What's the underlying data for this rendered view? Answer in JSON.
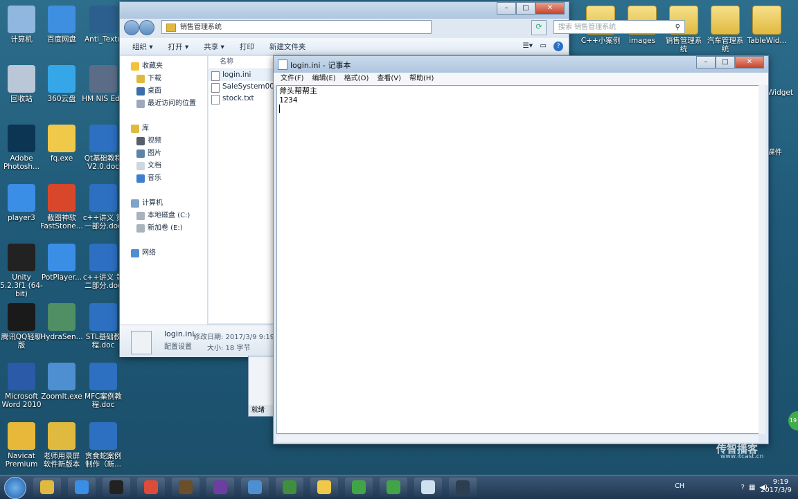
{
  "desktop_left": [
    {
      "label": "计算机",
      "icon": "computer-icon",
      "color": "#8fb7df"
    },
    {
      "label": "百度网盘",
      "icon": "baidu-netdisk-icon",
      "color": "#3e8fe0"
    },
    {
      "label": "Anti_Textu",
      "icon": "app-icon",
      "color": "#2c5f8d"
    },
    {
      "label": "回收站",
      "icon": "recycle-bin-icon",
      "color": "#b9c7d6"
    },
    {
      "label": "360云盘",
      "icon": "cloud-icon",
      "color": "#35a7e8"
    },
    {
      "label": "HM NIS Edit",
      "icon": "nsis-icon",
      "color": "#5b6d86"
    },
    {
      "label": "Adobe Photosh...",
      "icon": "photoshop-icon",
      "color": "#0b3553"
    },
    {
      "label": "fq.exe",
      "icon": "chat-icon",
      "color": "#f0c94a"
    },
    {
      "label": "Qt基础教程V2.0.doc",
      "icon": "word-doc-icon",
      "color": "#2d6fc1"
    },
    {
      "label": "player3",
      "icon": "player-icon",
      "color": "#3a8ee6"
    },
    {
      "label": "截图神软 FastStone...",
      "icon": "faststone-icon",
      "color": "#d9472b"
    },
    {
      "label": "c++讲义 第一部分.doc",
      "icon": "word-doc-icon",
      "color": "#2d6fc1"
    },
    {
      "label": "Unity 5.2.3f1 (64-bit)",
      "icon": "unity-icon",
      "color": "#222222"
    },
    {
      "label": "PotPlayer...",
      "icon": "potplayer-icon",
      "color": "#3a8ee6"
    },
    {
      "label": "c++讲义 第二部分.doc",
      "icon": "word-doc-icon",
      "color": "#2d6fc1"
    },
    {
      "label": "腾讯QQ轻聊版",
      "icon": "qq-icon",
      "color": "#1a1a1a"
    },
    {
      "label": "HydraSen...",
      "icon": "app-icon",
      "color": "#4f8f63"
    },
    {
      "label": "STL基础教程.doc",
      "icon": "word-doc-icon",
      "color": "#2d6fc1"
    },
    {
      "label": "Microsoft Word 2010",
      "icon": "word-icon",
      "color": "#2a5aa8"
    },
    {
      "label": "ZoomIt.exe",
      "icon": "zoom-icon",
      "color": "#4d8fd1"
    },
    {
      "label": "MFC案例教程.doc",
      "icon": "word-doc-icon",
      "color": "#2d6fc1"
    },
    {
      "label": "Navicat Premium",
      "icon": "navicat-icon",
      "color": "#e8b83a"
    },
    {
      "label": "老师用录屏软件新版本",
      "icon": "folder-icon",
      "color": "#e0b93f"
    },
    {
      "label": "贪食蛇案例制作（新...",
      "icon": "word-doc-icon",
      "color": "#2d6fc1"
    }
  ],
  "desktop_right": [
    {
      "label": "C++小案例",
      "icon": "folder-icon"
    },
    {
      "label": "images",
      "icon": "folder-icon"
    },
    {
      "label": "销售管理系统",
      "icon": "folder-icon"
    },
    {
      "label": "汽车管理系统",
      "icon": "folder-icon"
    },
    {
      "label": "TableWid...",
      "icon": "folder-icon"
    }
  ],
  "desktop_partial": {
    "widget": "Widget",
    "course": "课件"
  },
  "explorer": {
    "address": "销售管理系统",
    "search_placeholder": "搜索 销售管理系统",
    "toolbar": [
      "组织 ▾",
      "打开 ▾",
      "共享 ▾",
      "打印",
      "新建文件夹"
    ],
    "column_header": "名称",
    "nav": [
      {
        "label": "收藏夹",
        "indent": 0,
        "icon": "star-icon",
        "color": "#f2c23c"
      },
      {
        "label": "下载",
        "indent": 1,
        "icon": "download-folder-icon",
        "color": "#e0b93f"
      },
      {
        "label": "桌面",
        "indent": 1,
        "icon": "desktop-icon",
        "color": "#3c6ea8"
      },
      {
        "label": "最近访问的位置",
        "indent": 1,
        "icon": "recent-icon",
        "color": "#9aa9bb"
      },
      {
        "label": "",
        "indent": 0,
        "icon": "",
        "color": ""
      },
      {
        "label": "库",
        "indent": 0,
        "icon": "library-icon",
        "color": "#e0b93f"
      },
      {
        "label": "视频",
        "indent": 1,
        "icon": "video-icon",
        "color": "#555f6e"
      },
      {
        "label": "图片",
        "indent": 1,
        "icon": "pictures-icon",
        "color": "#5d83a8"
      },
      {
        "label": "文档",
        "indent": 1,
        "icon": "documents-icon",
        "color": "#cfd6df"
      },
      {
        "label": "音乐",
        "indent": 1,
        "icon": "music-icon",
        "color": "#3f7fd0"
      },
      {
        "label": "",
        "indent": 0,
        "icon": "",
        "color": ""
      },
      {
        "label": "计算机",
        "indent": 0,
        "icon": "computer-icon",
        "color": "#7fa4c9"
      },
      {
        "label": "本地磁盘 (C:)",
        "indent": 1,
        "icon": "drive-icon",
        "color": "#a9b3bd"
      },
      {
        "label": "新加卷 (E:)",
        "indent": 1,
        "icon": "drive-icon",
        "color": "#a9b3bd"
      },
      {
        "label": "",
        "indent": 0,
        "icon": "",
        "color": ""
      },
      {
        "label": "网络",
        "indent": 0,
        "icon": "network-icon",
        "color": "#4d8fd1"
      }
    ],
    "files": [
      {
        "name": "login.ini",
        "icon": "ini-file-icon"
      },
      {
        "name": "SaleSystem00",
        "icon": "exe-file-icon"
      },
      {
        "name": "stock.txt",
        "icon": "text-file-icon"
      }
    ],
    "details": {
      "name": "login.ini",
      "type": "配置设置",
      "modified": "修改日期: 2017/3/9 9:19",
      "size": "大小: 18 字节"
    },
    "status_partial": "就绪"
  },
  "notepad": {
    "title": "login.ini - 记事本",
    "menu": [
      "文件(F)",
      "编辑(E)",
      "格式(O)",
      "查看(V)",
      "帮助(H)"
    ],
    "lines": [
      "斧头帮帮主",
      "1234",
      ""
    ]
  },
  "taskbar": {
    "apps": [
      "explorer-folder-icon",
      "player3-icon",
      "unity-icon",
      "chrome-icon",
      "sublime-icon",
      "visual-studio-icon",
      "app-icon",
      "evernote-icon",
      "chat-icon",
      "qt-icon",
      "qt-creator-icon",
      "notepad-icon",
      "screen-recorder-icon"
    ],
    "time": "9:19",
    "date": "2017/3/9",
    "tray_label": "CH"
  },
  "watermark": {
    "site": "www.itcast.cn",
    "brand": "传智播客"
  },
  "badge": "19"
}
